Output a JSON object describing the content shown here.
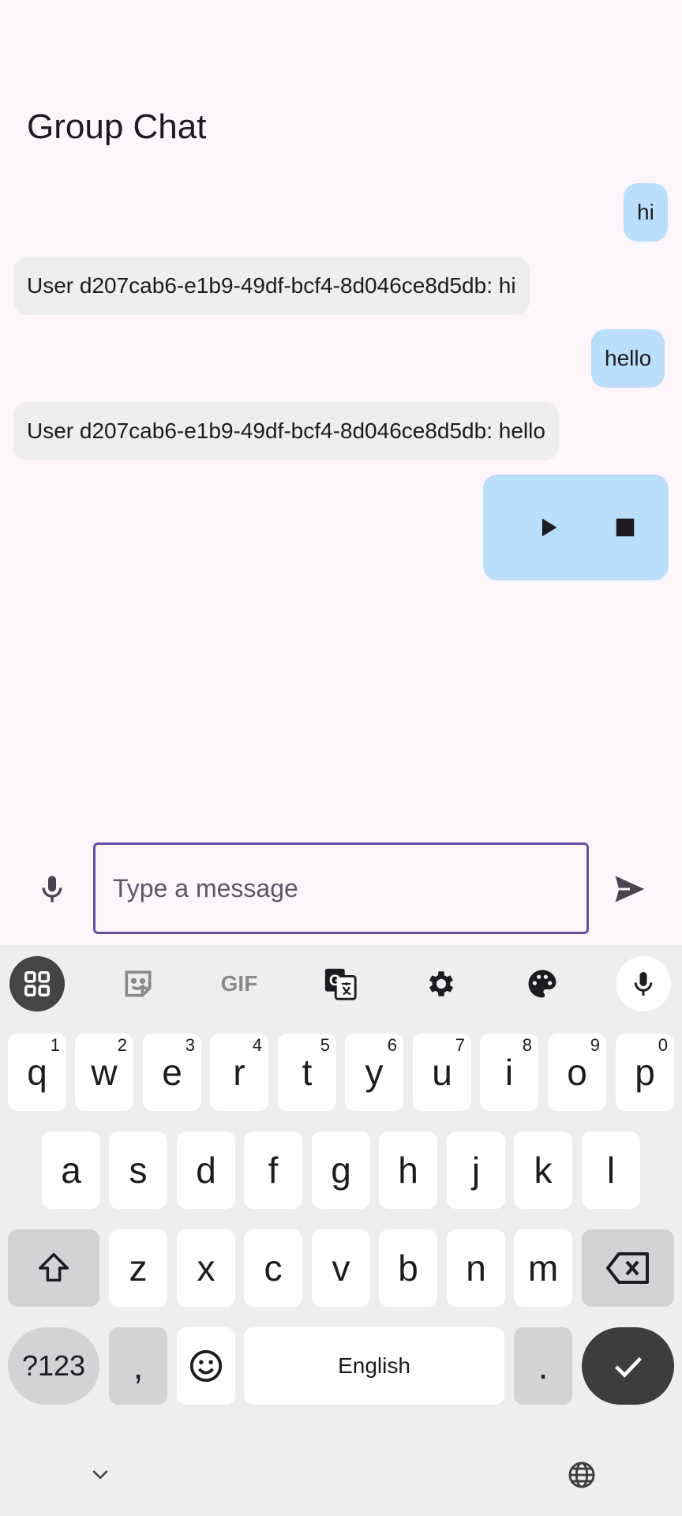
{
  "app": {
    "title": "Group Chat"
  },
  "messages": [
    {
      "from": "me",
      "text": "hi"
    },
    {
      "from": "them",
      "text": "User d207cab6-e1b9-49df-bcf4-8d046ce8d5db: hi"
    },
    {
      "from": "me",
      "text": "hello"
    },
    {
      "from": "them",
      "text": "User d207cab6-e1b9-49df-bcf4-8d046ce8d5db: hello"
    }
  ],
  "audio_message": {
    "play_icon": "play-icon",
    "stop_icon": "stop-icon"
  },
  "composer": {
    "placeholder": "Type a message",
    "value": "",
    "mic_icon": "mic-icon",
    "send_icon": "send-icon"
  },
  "keyboard": {
    "toolbar": [
      "apps-grid-icon",
      "sticker-icon",
      "gif-icon",
      "translate-icon",
      "settings-icon",
      "palette-icon",
      "voice-input-icon"
    ],
    "row1": [
      {
        "key": "q",
        "hint": "1"
      },
      {
        "key": "w",
        "hint": "2"
      },
      {
        "key": "e",
        "hint": "3"
      },
      {
        "key": "r",
        "hint": "4"
      },
      {
        "key": "t",
        "hint": "5"
      },
      {
        "key": "y",
        "hint": "6"
      },
      {
        "key": "u",
        "hint": "7"
      },
      {
        "key": "i",
        "hint": "8"
      },
      {
        "key": "o",
        "hint": "9"
      },
      {
        "key": "p",
        "hint": "0"
      }
    ],
    "row2": [
      "a",
      "s",
      "d",
      "f",
      "g",
      "h",
      "j",
      "k",
      "l"
    ],
    "row3": [
      "z",
      "x",
      "c",
      "v",
      "b",
      "n",
      "m"
    ],
    "symbols_label": "?123",
    "comma_label": ",",
    "space_label": "English",
    "period_label": ".",
    "gif_label": "GIF"
  },
  "colors": {
    "background": "#fdf6fb",
    "my_bubble": "#bbdefb",
    "their_bubble": "#eeeeee",
    "accent": "#6750a4",
    "keyboard_bg": "#eeeeef",
    "enter_key": "#3d3d3f"
  }
}
